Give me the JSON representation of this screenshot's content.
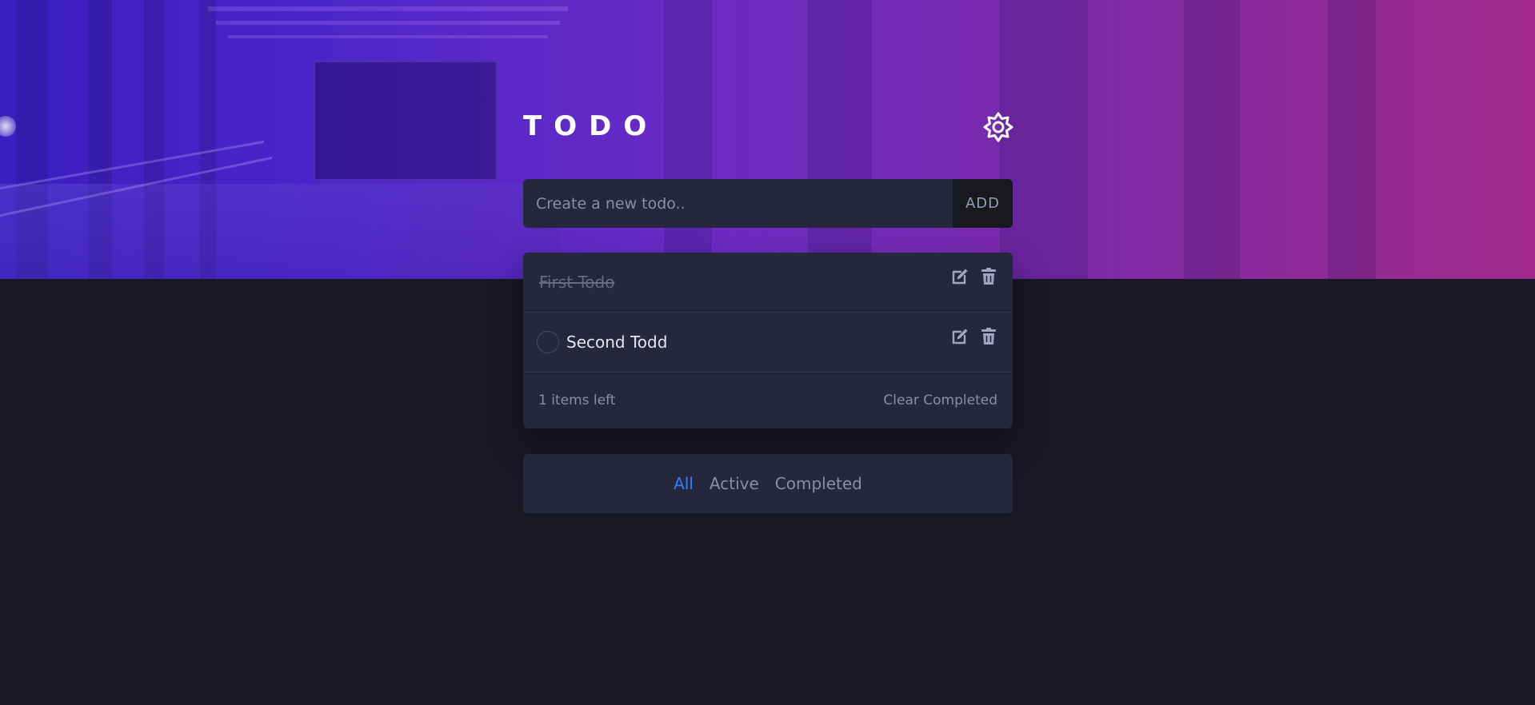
{
  "header": {
    "title": "TODO",
    "theme_icon": "sun-gear-icon"
  },
  "new_todo": {
    "placeholder": "Create a new todo..",
    "value": "",
    "add_label": "ADD"
  },
  "todos": [
    {
      "text": "First Todo",
      "completed": true
    },
    {
      "text": "Second Todd",
      "completed": false
    }
  ],
  "footer": {
    "items_left": "1 items left",
    "clear_label": "Clear Completed"
  },
  "filters": {
    "all": "All",
    "active": "Active",
    "completed": "Completed",
    "selected": "All"
  },
  "colors": {
    "accent": "#3a7cfd",
    "card": "#25273c",
    "background": "#181824"
  }
}
